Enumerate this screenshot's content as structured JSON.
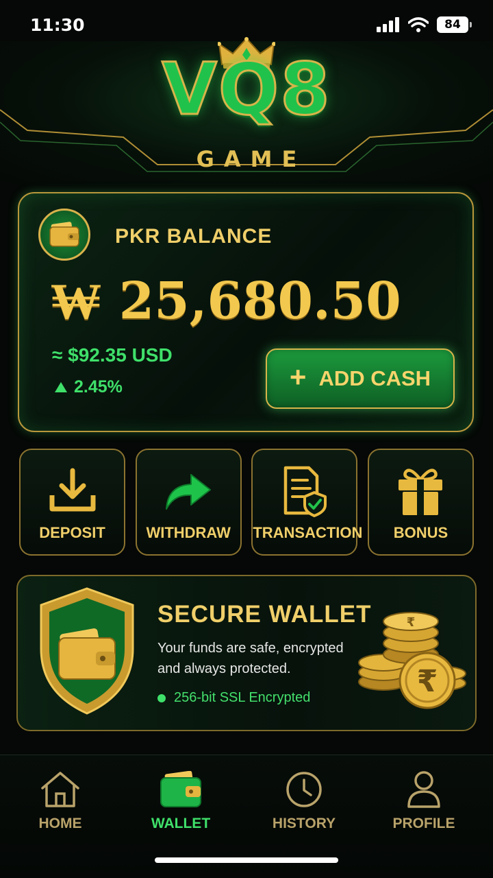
{
  "status_bar": {
    "time": "11:30",
    "battery": "84"
  },
  "header": {
    "logo": "VQ8",
    "subtitle": "GAME"
  },
  "balance": {
    "label": "PKR BALANCE",
    "amount": "₩ 25,680.50",
    "usd": "≈ $92.35 USD",
    "change": "2.45%",
    "add_cash_label": "ADD CASH",
    "icon": "wallet-icon"
  },
  "actions": [
    {
      "label": "DEPOSIT",
      "icon": "download-icon"
    },
    {
      "label": "WITHDRAW",
      "icon": "share-arrow-icon"
    },
    {
      "label": "TRANSACTION",
      "icon": "document-shield-icon"
    },
    {
      "label": "BONUS",
      "icon": "gift-icon"
    }
  ],
  "secure": {
    "title": "SECURE WALLET",
    "text": "Your funds are safe, encrypted and always protected.",
    "badge": "256-bit SSL Encrypted"
  },
  "nav": {
    "items": [
      {
        "label": "HOME",
        "icon": "home-icon",
        "active": false
      },
      {
        "label": "WALLET",
        "icon": "wallet-icon",
        "active": true
      },
      {
        "label": "HISTORY",
        "icon": "clock-icon",
        "active": false
      },
      {
        "label": "PROFILE",
        "icon": "user-icon",
        "active": false
      }
    ]
  },
  "colors": {
    "gold": "#f0cf6a",
    "green": "#3fe06a",
    "background": "#050806"
  }
}
